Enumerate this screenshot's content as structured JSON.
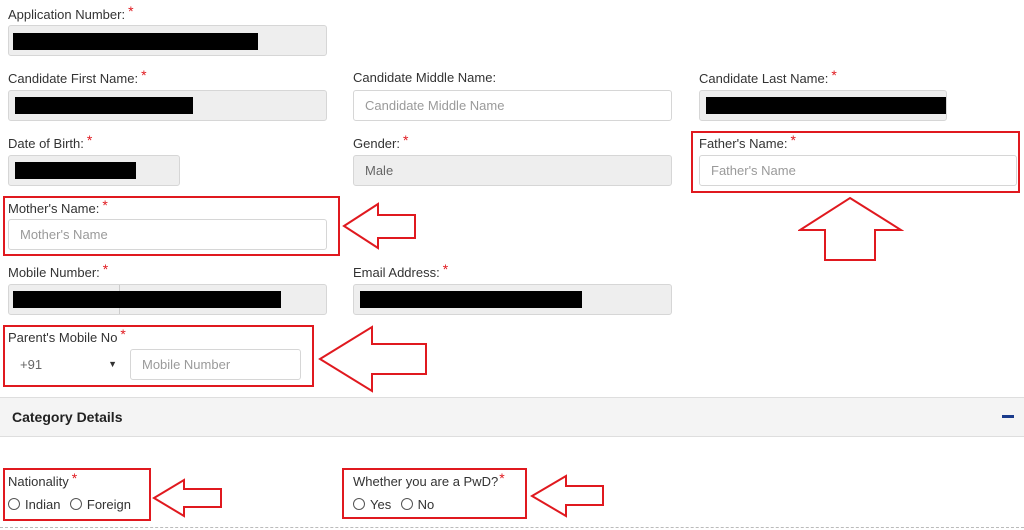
{
  "application_number": {
    "label": "Application Number:"
  },
  "candidate": {
    "first_name_label": "Candidate First Name:",
    "middle_name_label": "Candidate Middle Name:",
    "middle_name_placeholder": "Candidate Middle Name",
    "last_name_label": "Candidate Last Name:"
  },
  "dob": {
    "label": "Date of Birth:"
  },
  "gender": {
    "label": "Gender:",
    "value": "Male"
  },
  "father": {
    "label": "Father's Name:",
    "placeholder": "Father's Name"
  },
  "mother": {
    "label": "Mother's Name:",
    "placeholder": "Mother's Name"
  },
  "mobile": {
    "label": "Mobile Number:"
  },
  "email": {
    "label": "Email Address:"
  },
  "parent_mobile": {
    "label": "Parent's Mobile No",
    "country_code": "+91",
    "placeholder": "Mobile Number"
  },
  "category_section": {
    "title": "Category Details"
  },
  "nationality": {
    "label": "Nationality",
    "options": [
      "Indian",
      "Foreign"
    ]
  },
  "pwd": {
    "label": "Whether you are a PwD?",
    "options": [
      "Yes",
      "No"
    ]
  },
  "required_mark": "*",
  "colors": {
    "required": "#e0191f",
    "highlight": "#e0191f",
    "collapse": "#1a3b8c"
  }
}
